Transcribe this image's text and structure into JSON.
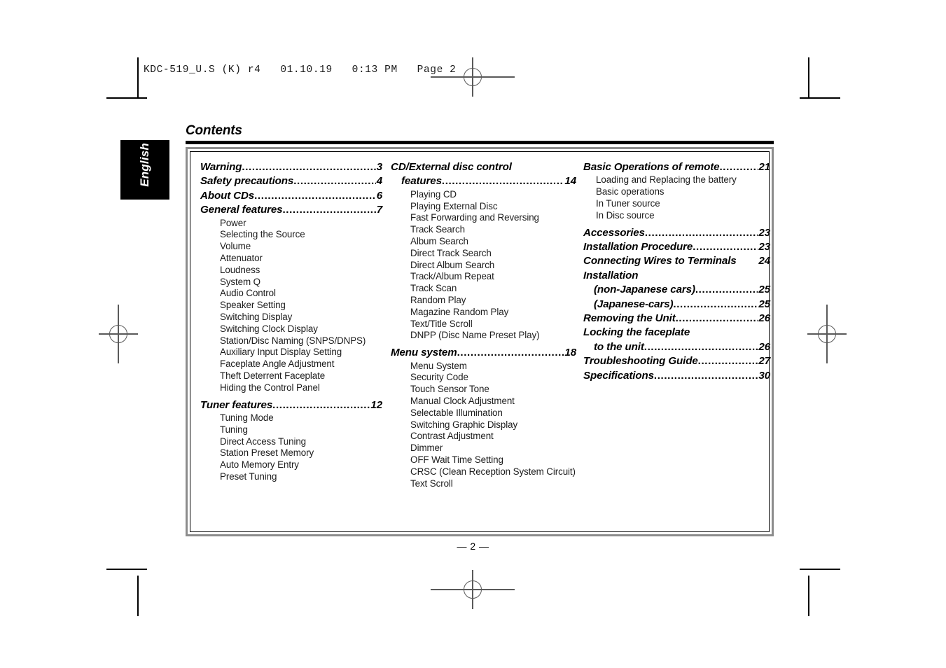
{
  "slug": {
    "text": "KDC-519_U.S (K) r4   01.10.19   0:13 PM   Page 2"
  },
  "page": {
    "title": "Contents",
    "language_tab": "English",
    "page_number": "— 2 —"
  },
  "columns": [
    {
      "id": "column-1",
      "blocks": [
        {
          "type": "entry",
          "label": "Warning",
          "leader": true,
          "page": "3"
        },
        {
          "type": "entry",
          "label": "Safety precautions",
          "leader": true,
          "page": "4"
        },
        {
          "type": "entry",
          "label": "About CDs",
          "leader": true,
          "page": "6"
        },
        {
          "type": "entry",
          "label": "General features",
          "leader": true,
          "page": "7"
        },
        {
          "type": "subs",
          "items": [
            "Power",
            "Selecting the Source",
            "Volume",
            "Attenuator",
            "Loudness",
            "System Q",
            "Audio Control",
            "Speaker Setting",
            "Switching Display",
            "Switching Clock Display",
            "Station/Disc Naming (SNPS/DNPS)",
            "Auxiliary Input Display Setting",
            "Faceplate Angle Adjustment",
            "Theft Deterrent Faceplate",
            "Hiding the Control Panel"
          ]
        },
        {
          "type": "entry",
          "label": "Tuner features",
          "leader": true,
          "page": "12"
        },
        {
          "type": "subs",
          "items": [
            "Tuning Mode",
            "Tuning",
            "Direct Access Tuning",
            "Station Preset Memory",
            "Auto Memory Entry",
            "Preset Tuning"
          ]
        }
      ]
    },
    {
      "id": "column-2",
      "blocks": [
        {
          "type": "entry",
          "label": "CD/External disc control",
          "leader": false,
          "page": ""
        },
        {
          "type": "entry",
          "label": "features",
          "leader": true,
          "page": "14",
          "indent": true
        },
        {
          "type": "subs",
          "items": [
            "Playing CD",
            "Playing External Disc",
            "Fast Forwarding and Reversing",
            "Track Search",
            "Album Search",
            "Direct Track Search",
            "Direct Album Search",
            "Track/Album Repeat",
            "Track Scan",
            "Random Play",
            "Magazine Random Play",
            "Text/Title Scroll",
            "DNPP (Disc Name Preset Play)"
          ]
        },
        {
          "type": "entry",
          "label": "Menu system",
          "leader": true,
          "page": "18"
        },
        {
          "type": "subs",
          "items": [
            "Menu System",
            "Security Code",
            "Touch Sensor Tone",
            "Manual Clock Adjustment",
            "Selectable Illumination",
            "Switching Graphic Display",
            "Contrast Adjustment",
            "Dimmer",
            "OFF Wait Time Setting",
            "CRSC (Clean Reception System Circuit)",
            "Text Scroll"
          ]
        }
      ]
    },
    {
      "id": "column-3",
      "blocks": [
        {
          "type": "entry",
          "label": "Basic Operations of remote",
          "leader": true,
          "page": "21"
        },
        {
          "type": "subs",
          "items": [
            "Loading and Replacing the battery",
            "Basic operations",
            "In Tuner source",
            "In Disc source"
          ]
        },
        {
          "type": "entry",
          "label": "Accessories",
          "leader": true,
          "page": "23"
        },
        {
          "type": "entry",
          "label": "Installation Procedure",
          "leader": true,
          "page": "23"
        },
        {
          "type": "entry",
          "label": "Connecting Wires to Terminals",
          "leader": false,
          "page": "24"
        },
        {
          "type": "entry",
          "label": "Installation",
          "leader": false,
          "page": ""
        },
        {
          "type": "entry",
          "label": "(non-Japanese cars)",
          "leader": true,
          "page": "25",
          "indent": true
        },
        {
          "type": "entry",
          "label": "(Japanese-cars)",
          "leader": true,
          "page": "25",
          "indent": true
        },
        {
          "type": "entry",
          "label": "Removing the Unit",
          "leader": true,
          "page": "26"
        },
        {
          "type": "entry",
          "label": "Locking the faceplate",
          "leader": false,
          "page": ""
        },
        {
          "type": "entry",
          "label": "to the unit",
          "leader": true,
          "page": "26",
          "indent": true
        },
        {
          "type": "entry",
          "label": "Troubleshooting Guide",
          "leader": true,
          "page": "27"
        },
        {
          "type": "entry",
          "label": "Specifications",
          "leader": true,
          "page": "30"
        }
      ]
    }
  ]
}
